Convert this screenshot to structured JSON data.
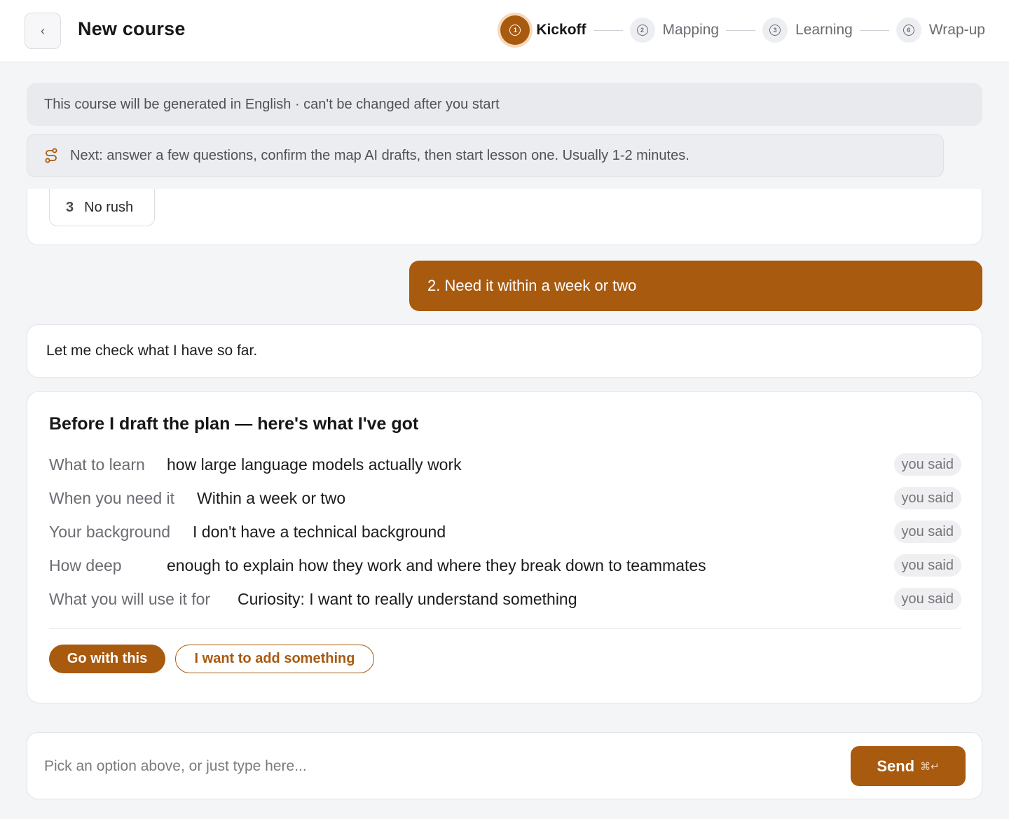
{
  "header": {
    "back_icon": "chevron-left-icon",
    "back_glyph": "‹",
    "title": "New course",
    "steps": [
      {
        "number": "1",
        "label": "Kickoff",
        "active": true
      },
      {
        "number": "2",
        "label": "Mapping",
        "active": false
      },
      {
        "number": "3",
        "label": "Learning",
        "active": false
      },
      {
        "number": "6",
        "label": "Wrap-up",
        "active": false
      }
    ]
  },
  "banners": {
    "language": "This course will be generated in English · can't be changed after you start",
    "next_icon": "route-icon",
    "next": "Next: answer a few questions, confirm the map AI drafts, then start lesson one. Usually 1-2 minutes."
  },
  "previous_options": {
    "visible_option": {
      "number": "3",
      "label": "No rush"
    }
  },
  "user_message": "2. Need it within a week or two",
  "assistant_message": "Let me check what I have so far.",
  "summary": {
    "title": "Before I draft the plan — here's what I've got",
    "rows": [
      {
        "label": "What to learn",
        "value": "how large language models actually work",
        "badge": "you said"
      },
      {
        "label": "When you need it",
        "value": "Within a week or two",
        "badge": "you said"
      },
      {
        "label": "Your background",
        "value": "I don't have a technical background",
        "badge": "you said"
      },
      {
        "label": "How deep",
        "value": "enough to explain how they work and where they break down to teammates",
        "badge": "you said"
      },
      {
        "label": "What you will use it for",
        "value": "Curiosity: I want to really understand something",
        "badge": "you said"
      }
    ],
    "primary_button": "Go with this",
    "secondary_button": "I want to add something"
  },
  "composer": {
    "placeholder": "Pick an option above, or just type here...",
    "value": "",
    "send_label": "Send",
    "send_shortcut": "⌘↵"
  },
  "colors": {
    "accent": "#a85a0f",
    "accent_ring": "#f6d9bc",
    "background": "#f4f5f7"
  }
}
